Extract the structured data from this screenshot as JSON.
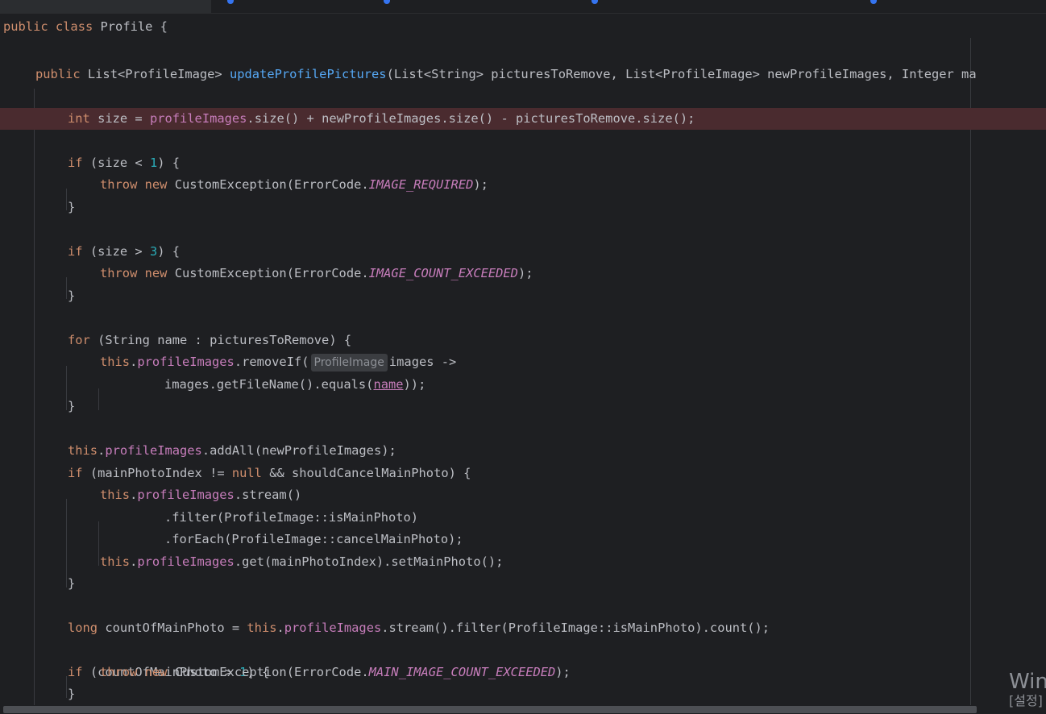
{
  "editor": {
    "class_decl": {
      "kw1": "public",
      "kw2": "class",
      "name": "Profile",
      "brace": "{"
    },
    "method_decl": {
      "kw": "public",
      "return_type": "List<",
      "return_generic": "ProfileImage>",
      "name": "updateProfilePictures",
      "params": "(List<String> picturesToRemove, List<ProfileImage> newProfileImages, Integer ma"
    },
    "size_line": {
      "kw": "int",
      "rest1": " size = ",
      "field": "profileImages",
      "rest2": ".size() + newProfileImages.size() - picturesToRemove.size();"
    },
    "if1": {
      "kw": "if",
      "rest1": " (size < ",
      "num": "1",
      "rest2": ") {"
    },
    "throw1": {
      "kw1": "throw",
      "kw2": "new",
      "rest1": " CustomException(ErrorCode.",
      "const": "IMAGE_REQUIRED",
      "rest2": ");"
    },
    "close": "}",
    "if2": {
      "kw": "if",
      "rest1": " (size > ",
      "num": "3",
      "rest2": ") {"
    },
    "throw2": {
      "kw1": "throw",
      "kw2": "new",
      "rest1": " CustomException(ErrorCode.",
      "const": "IMAGE_COUNT_EXCEEDED",
      "rest2": ");"
    },
    "for_line": {
      "kw": "for",
      "rest": " (String name : picturesToRemove) {"
    },
    "remove_line": {
      "kw": "this",
      "dot": ".",
      "field": "profileImages",
      "rest1": ".removeIf(",
      "hint": "ProfileImage",
      "rest2": "images ->"
    },
    "equals_line": {
      "rest1": "images.getFileName().equals(",
      "ref": "name",
      "rest2": "));"
    },
    "addall_line": {
      "kw": "this",
      "dot": ".",
      "field": "profileImages",
      "rest": ".addAll(newProfileImages);"
    },
    "if3": {
      "kw": "if",
      "rest1": " (mainPhotoIndex != ",
      "kw2": "null",
      "rest2": " && shouldCancelMainPhoto) {"
    },
    "stream_line": {
      "kw": "this",
      "dot": ".",
      "field": "profileImages",
      "rest": ".stream()"
    },
    "filter_line": ".filter(ProfileImage::isMainPhoto)",
    "foreach_line": ".forEach(ProfileImage::cancelMainPhoto);",
    "set_line": {
      "kw": "this",
      "dot": ".",
      "field": "profileImages",
      "rest": ".get(mainPhotoIndex).setMainPhoto();"
    },
    "long_line": {
      "kw": "long",
      "rest1": " countOfMainPhoto = ",
      "kw2": "this",
      "dot": ".",
      "field": "profileImages",
      "rest2": ".stream().filter(ProfileImage::isMainPhoto).count();"
    },
    "if4": {
      "kw": "if",
      "rest1": " (countOfMainPhoto > ",
      "num": "1",
      "rest2": ") {"
    },
    "throw3": {
      "kw1": "throw",
      "kw2": "new",
      "rest1": " CustomException(ErrorCode.",
      "const": "MAIN_IMAGE_COUNT_EXCEEDED",
      "rest2": ");"
    }
  },
  "watermark": {
    "line1": "Win",
    "line2": "[설정]"
  },
  "colors": {
    "background": "#1e1f22",
    "keyword": "#cf8e6d",
    "method": "#56a8f5",
    "field": "#c77dbb",
    "number": "#2aacb8",
    "text": "#bcbec4",
    "error_line": "#4a2b2f"
  }
}
